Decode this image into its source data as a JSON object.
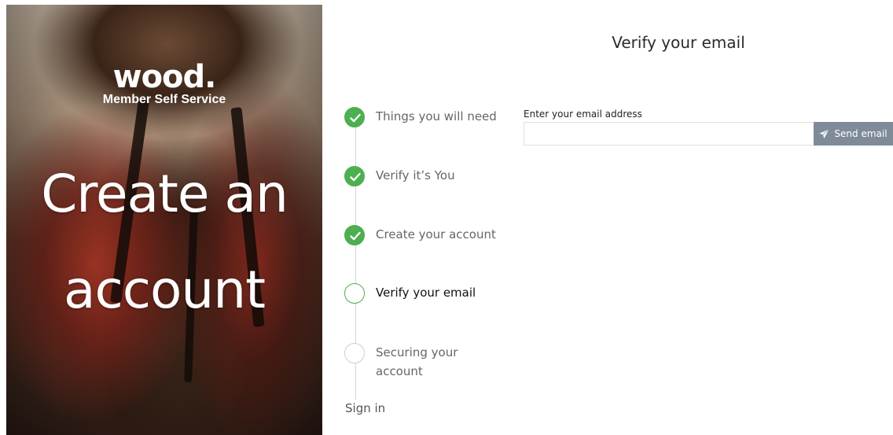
{
  "brand": {
    "logo_text": "wood.",
    "subtitle": "Member Self Service"
  },
  "hero": {
    "line1": "Create an",
    "line2": "account"
  },
  "page": {
    "title": "Verify your email"
  },
  "steps": [
    {
      "label": "Things you will need",
      "status": "complete"
    },
    {
      "label": "Verify it’s You",
      "status": "complete"
    },
    {
      "label": "Create your account",
      "status": "complete"
    },
    {
      "label": "Verify your email",
      "status": "current"
    },
    {
      "label": "Securing your account",
      "status": "pending"
    }
  ],
  "signin_label": "Sign in",
  "form": {
    "email_label": "Enter your email address",
    "email_value": "",
    "email_placeholder": "",
    "send_button_label": "Send email"
  },
  "icons": {
    "check": "check-icon",
    "send": "paper-plane-icon"
  },
  "colors": {
    "success": "#4caf50",
    "button": "#7f8b99",
    "text": "#2b2b2b"
  }
}
